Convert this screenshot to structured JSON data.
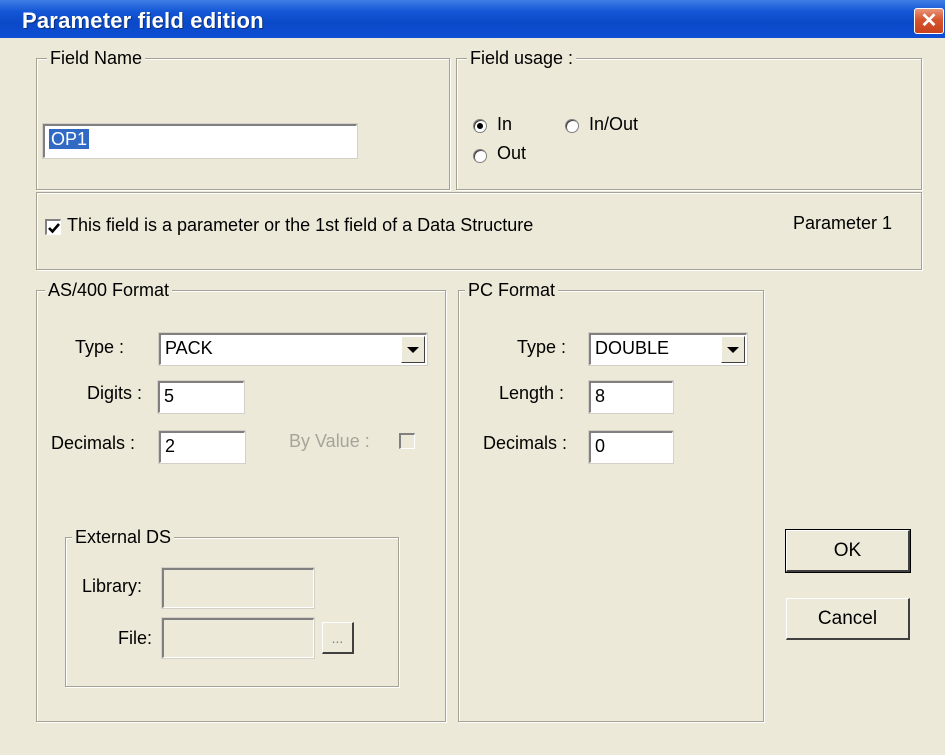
{
  "window": {
    "title": "Parameter field edition",
    "close_glyph": "✕"
  },
  "field_name": {
    "legend": "Field Name",
    "value": "OP1"
  },
  "field_usage": {
    "legend": "Field usage :",
    "options": [
      {
        "label": "In",
        "selected": true
      },
      {
        "label": "In/Out",
        "selected": false
      },
      {
        "label": "Out",
        "selected": false
      }
    ]
  },
  "parameter": {
    "checkbox_label": "This field is a parameter or the 1st field of a Data Structure",
    "checked": true,
    "status": "Parameter 1"
  },
  "as400": {
    "legend": "AS/400 Format",
    "type_label": "Type :",
    "type_value": "PACK",
    "digits_label": "Digits :",
    "digits_value": "5",
    "decimals_label": "Decimals :",
    "decimals_value": "2",
    "by_value_label": "By Value :",
    "by_value_checked": false,
    "external_ds": {
      "legend": "External DS",
      "library_label": "Library:",
      "library_value": "",
      "file_label": "File:",
      "file_value": "",
      "browse_label": "..."
    }
  },
  "pc": {
    "legend": "PC Format",
    "type_label": "Type :",
    "type_value": "DOUBLE",
    "length_label": "Length :",
    "length_value": "8",
    "decimals_label": "Decimals :",
    "decimals_value": "0"
  },
  "buttons": {
    "ok": "OK",
    "cancel": "Cancel"
  },
  "colors": {
    "title_bar": "#0a49c8",
    "dialog_bg": "#ece9d8",
    "selection": "#316ac5",
    "close_button": "#d6542c"
  }
}
